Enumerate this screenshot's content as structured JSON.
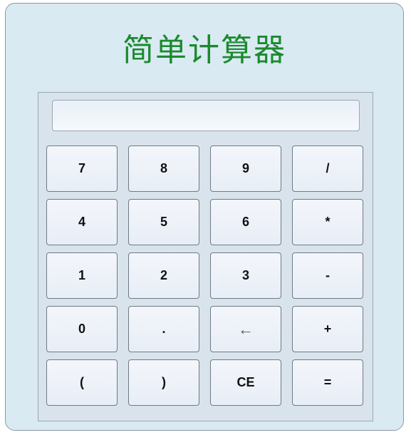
{
  "app": {
    "title": "简单计算器"
  },
  "display": {
    "value": ""
  },
  "keys": [
    {
      "label": "7",
      "name": "key-7-button"
    },
    {
      "label": "8",
      "name": "key-8-button"
    },
    {
      "label": "9",
      "name": "key-9-button"
    },
    {
      "label": "/",
      "name": "key-divide-button"
    },
    {
      "label": "4",
      "name": "key-4-button"
    },
    {
      "label": "5",
      "name": "key-5-button"
    },
    {
      "label": "6",
      "name": "key-6-button"
    },
    {
      "label": "*",
      "name": "key-multiply-button"
    },
    {
      "label": "1",
      "name": "key-1-button"
    },
    {
      "label": "2",
      "name": "key-2-button"
    },
    {
      "label": "3",
      "name": "key-3-button"
    },
    {
      "label": "-",
      "name": "key-subtract-button"
    },
    {
      "label": "0",
      "name": "key-0-button"
    },
    {
      "label": ".",
      "name": "key-decimal-button"
    },
    {
      "label": "←",
      "name": "backspace-button",
      "kind": "backspace"
    },
    {
      "label": "+",
      "name": "key-add-button"
    },
    {
      "label": "(",
      "name": "key-open-paren-button"
    },
    {
      "label": ")",
      "name": "key-close-paren-button"
    },
    {
      "label": "CE",
      "name": "clear-entry-button"
    },
    {
      "label": "=",
      "name": "equals-button"
    }
  ],
  "colors": {
    "title": "#1b8a2e",
    "frame_background": "#daeaf3",
    "panel_background": "#d8e3ec",
    "key_background": "#eef3fa"
  }
}
